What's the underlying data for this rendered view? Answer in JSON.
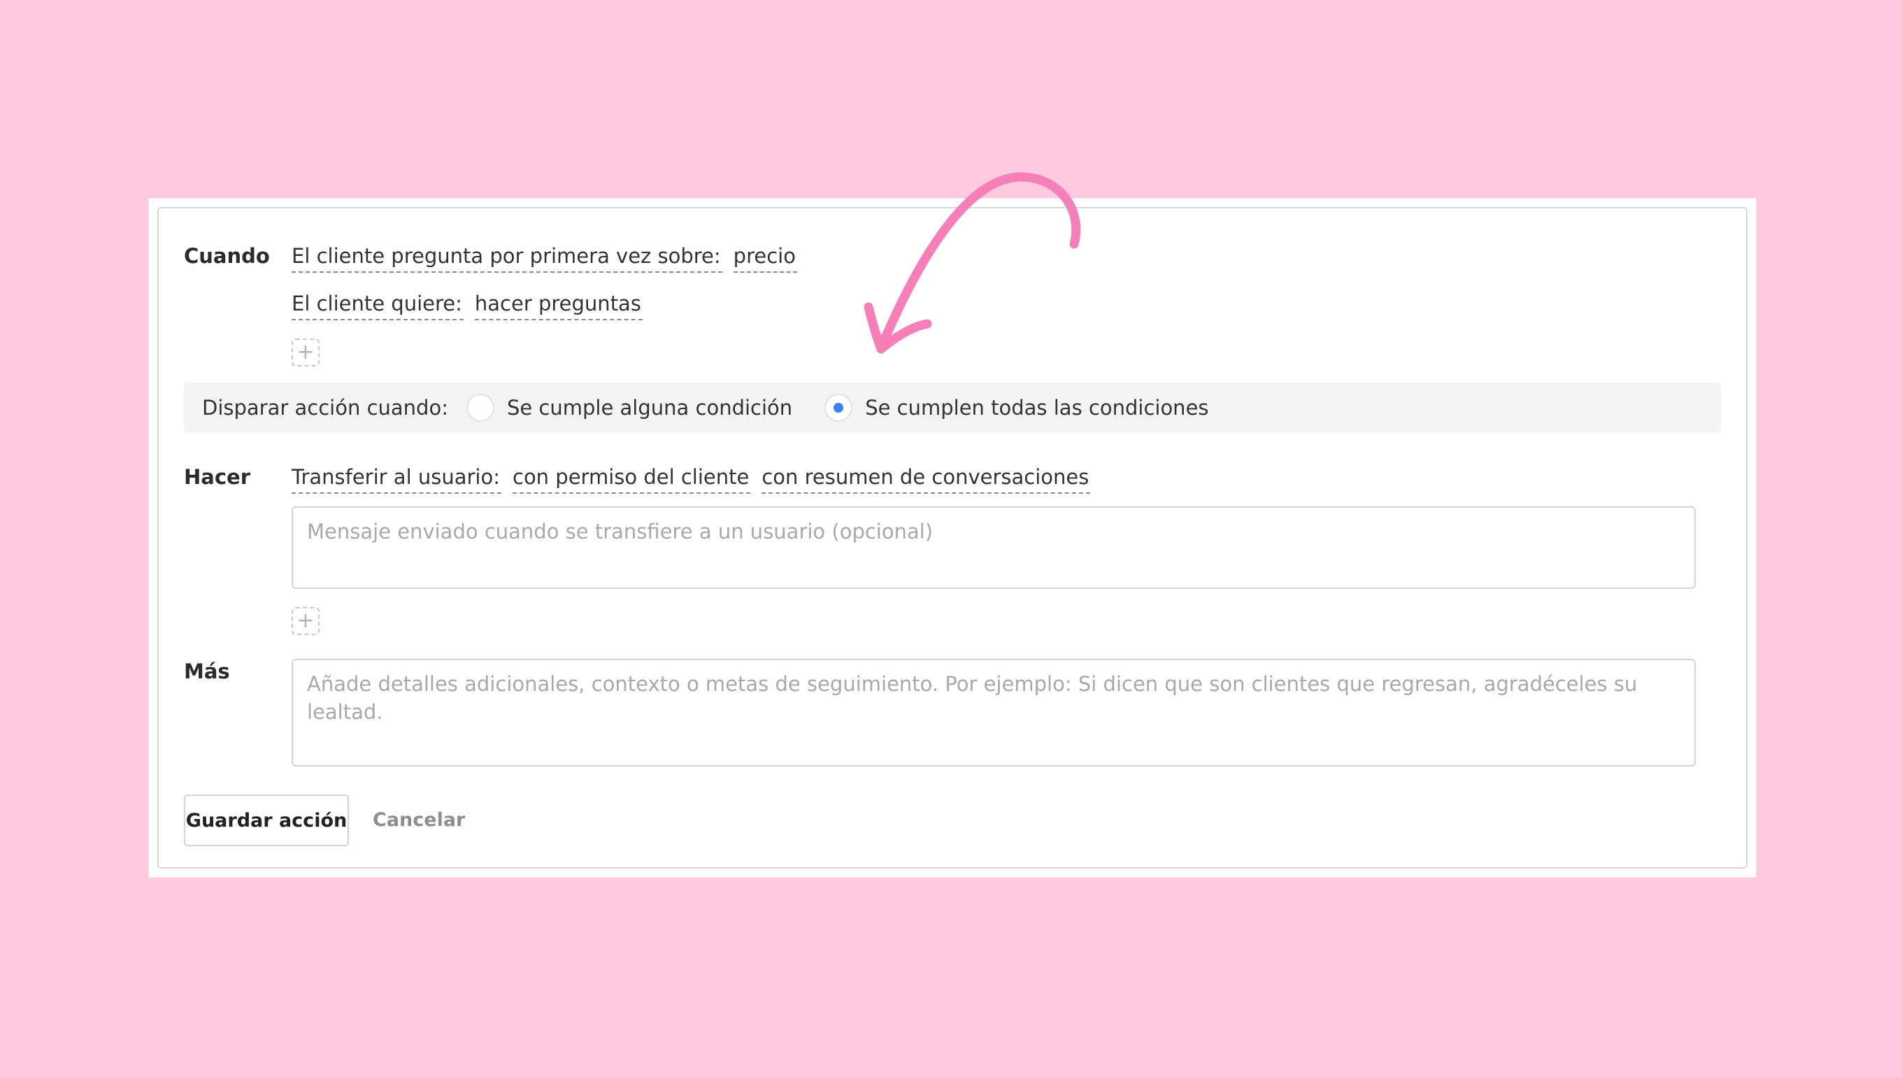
{
  "when": {
    "label": "Cuando",
    "conditions": [
      {
        "field": "El cliente pregunta por primera vez sobre:",
        "value": "precio"
      },
      {
        "field": "El cliente quiere:",
        "value": "hacer preguntas"
      }
    ],
    "add_symbol": "+"
  },
  "trigger": {
    "label": "Disparar acción cuando:",
    "options": [
      {
        "label": "Se cumple alguna condición",
        "selected": false
      },
      {
        "label": "Se cumplen todas las condiciones",
        "selected": true
      }
    ]
  },
  "do": {
    "label": "Hacer",
    "action": "Transferir al usuario:",
    "options": [
      "con permiso del cliente",
      "con resumen de conversaciones"
    ],
    "message_placeholder": "Mensaje enviado cuando se transfiere a un usuario (opcional)",
    "add_symbol": "+"
  },
  "more": {
    "label": "Más",
    "placeholder": "Añade detalles adicionales, contexto o metas de seguimiento. Por ejemplo: Si dicen que son clientes que regresan, agradéceles su lealtad."
  },
  "buttons": {
    "save": "Guardar acción",
    "cancel": "Cancelar"
  },
  "colors": {
    "background": "#ffc9e0",
    "arrow": "#f57fb6",
    "radio_selected": "#3b82f6"
  }
}
